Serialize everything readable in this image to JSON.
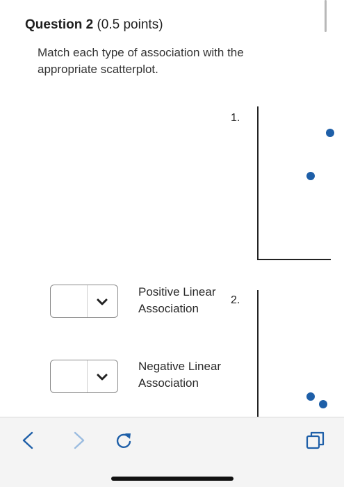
{
  "question": {
    "label": "Question 2",
    "points": "(0.5 points)",
    "prompt": "Match each type of association with the appropriate scatterplot."
  },
  "plots": [
    {
      "number": "1."
    },
    {
      "number": "2."
    }
  ],
  "matches": [
    {
      "selected_value": "",
      "label": "Positive Linear Association"
    },
    {
      "selected_value": "",
      "label": "Negative Linear Association"
    }
  ],
  "colors": {
    "dot": "#1e5fa8",
    "nav_active": "#1e5fa8",
    "nav_disabled": "#9bbce0"
  },
  "icons": {
    "back": "chevron-left-icon",
    "forward": "chevron-right-icon",
    "reload": "reload-icon",
    "tabs": "tabs-icon",
    "select_arrow": "chevron-down-icon"
  }
}
